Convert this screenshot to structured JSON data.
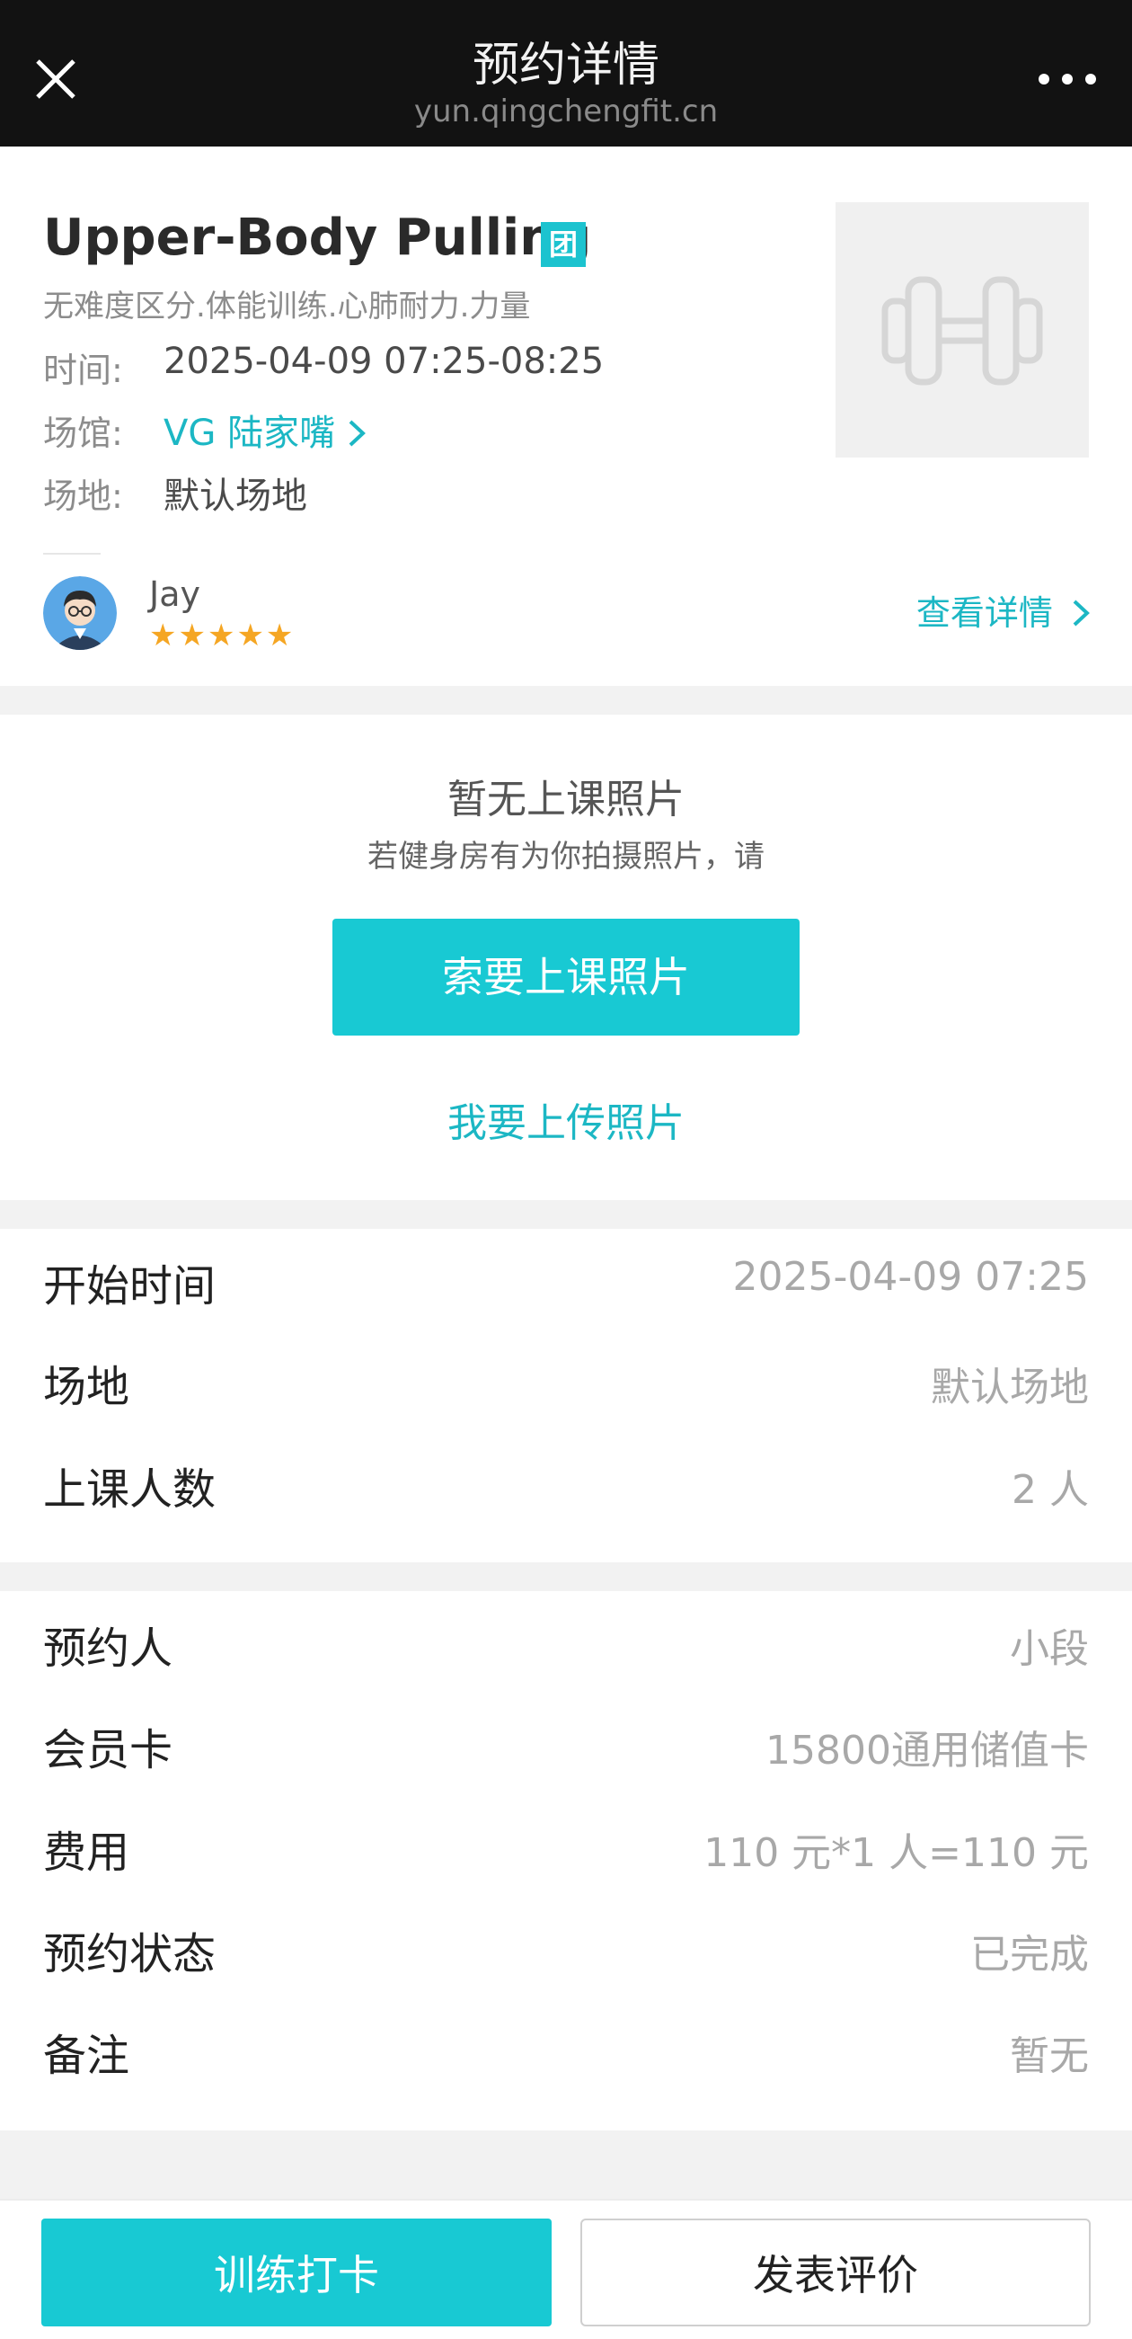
{
  "topbar": {
    "title": "预约详情",
    "url": "yun.qingchengfit.cn",
    "close_icon": "close-icon",
    "more_icon": "more-icon"
  },
  "class": {
    "name": "Upper-Body Pulling",
    "group_tag": "团",
    "tags": "无难度区分.体能训练.心肺耐力.力量",
    "time_label": "时间:",
    "time_value": "2025-04-09 07:25-08:25",
    "venue_label": "场馆:",
    "venue_value": "VG 陆家嘴",
    "site_label": "场地:",
    "site_value": "默认场地",
    "thumbnail_icon": "dumbbell-icon"
  },
  "coach": {
    "name": "Jay",
    "rating": 5,
    "stars": "★★★★★",
    "details_link": "查看详情"
  },
  "photos": {
    "empty_title": "暂无上课照片",
    "hint": "若健身房有为你拍摄照片，请",
    "request_button": "索要上课照片",
    "upload_link": "我要上传照片"
  },
  "session_info": [
    {
      "label": "开始时间",
      "value": "2025-04-09 07:25"
    },
    {
      "label": "场地",
      "value": "默认场地"
    },
    {
      "label": "上课人数",
      "value": "2 人"
    }
  ],
  "booking_info": [
    {
      "label": "预约人",
      "value": "小段"
    },
    {
      "label": "会员卡",
      "value": "15800通用储值卡"
    },
    {
      "label": "费用",
      "value": "110 元*1 人=110 元"
    },
    {
      "label": "预约状态",
      "value": "已完成"
    },
    {
      "label": "备注",
      "value": "暂无"
    }
  ],
  "actions": {
    "checkin_button": "训练打卡",
    "review_button": "发表评价"
  },
  "colors": {
    "accent": "#18c9d3",
    "topbar_bg": "#121212",
    "star": "#f5a623"
  }
}
